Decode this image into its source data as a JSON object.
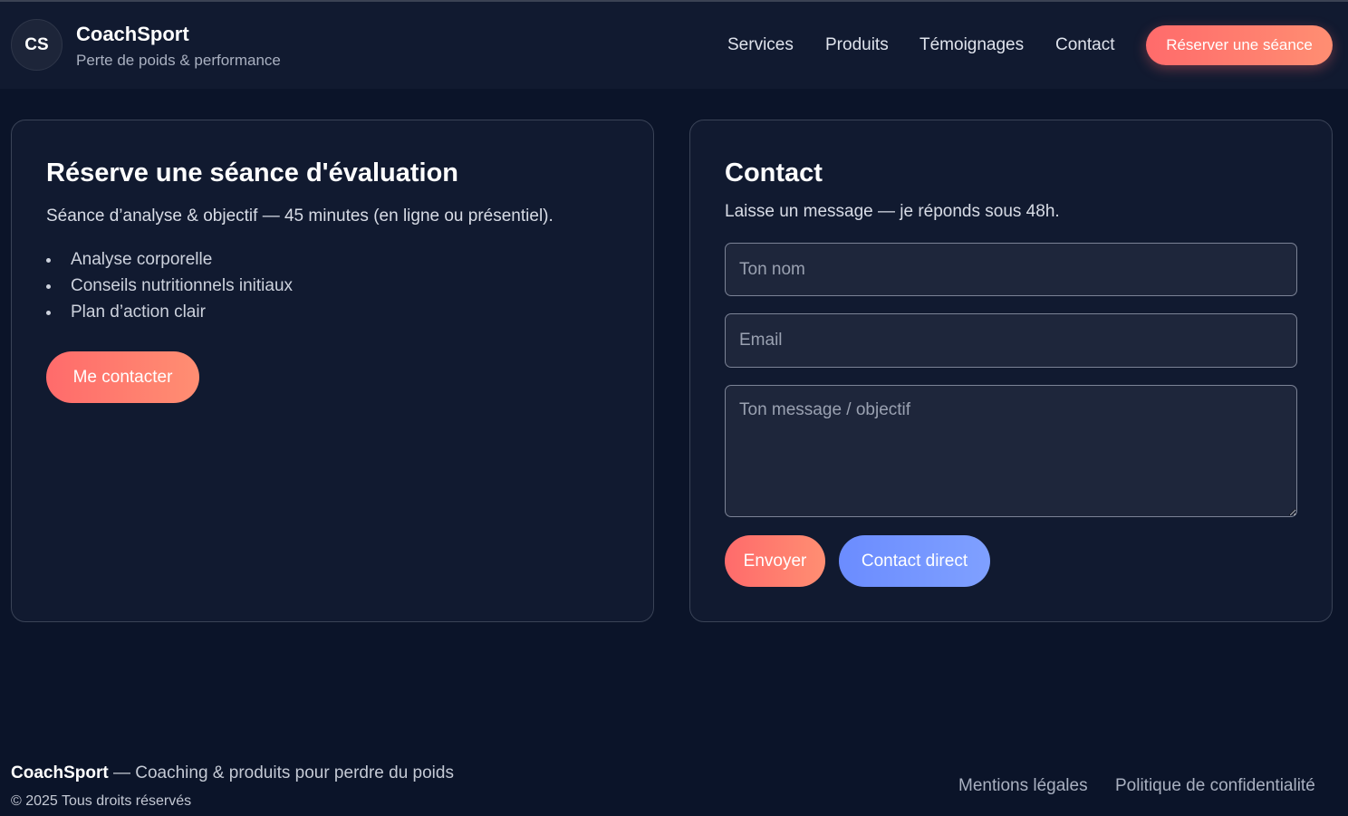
{
  "header": {
    "logo_initials": "CS",
    "brand_name": "CoachSport",
    "brand_tagline": "Perte de poids & performance",
    "nav": {
      "services": "Services",
      "produits": "Produits",
      "temoignages": "Témoignages",
      "contact": "Contact"
    },
    "cta_label": "Réserver une séance"
  },
  "booking": {
    "title": "Réserve une séance d'évaluation",
    "description": "Séance d’analyse & objectif — 45 minutes (en ligne ou présentiel).",
    "features": [
      "Analyse corporelle",
      "Conseils nutritionnels initiaux",
      "Plan d’action clair"
    ],
    "button_label": "Me contacter"
  },
  "contact": {
    "title": "Contact",
    "description": "Laisse un message — je réponds sous 48h.",
    "name_placeholder": "Ton nom",
    "email_placeholder": "Email",
    "message_placeholder": "Ton message / objectif",
    "send_label": "Envoyer",
    "direct_label": "Contact direct"
  },
  "footer": {
    "brand": "CoachSport",
    "tagline": " — Coaching & produits pour perdre du poids",
    "copyright": "© 2025 Tous droits réservés",
    "mentions": "Mentions légales",
    "privacy": "Politique de confidentialité"
  },
  "colors": {
    "background": "#0b1429",
    "card": "#111a30",
    "accent_coral": "#ff6b6b",
    "accent_blue": "#6b8cff"
  }
}
